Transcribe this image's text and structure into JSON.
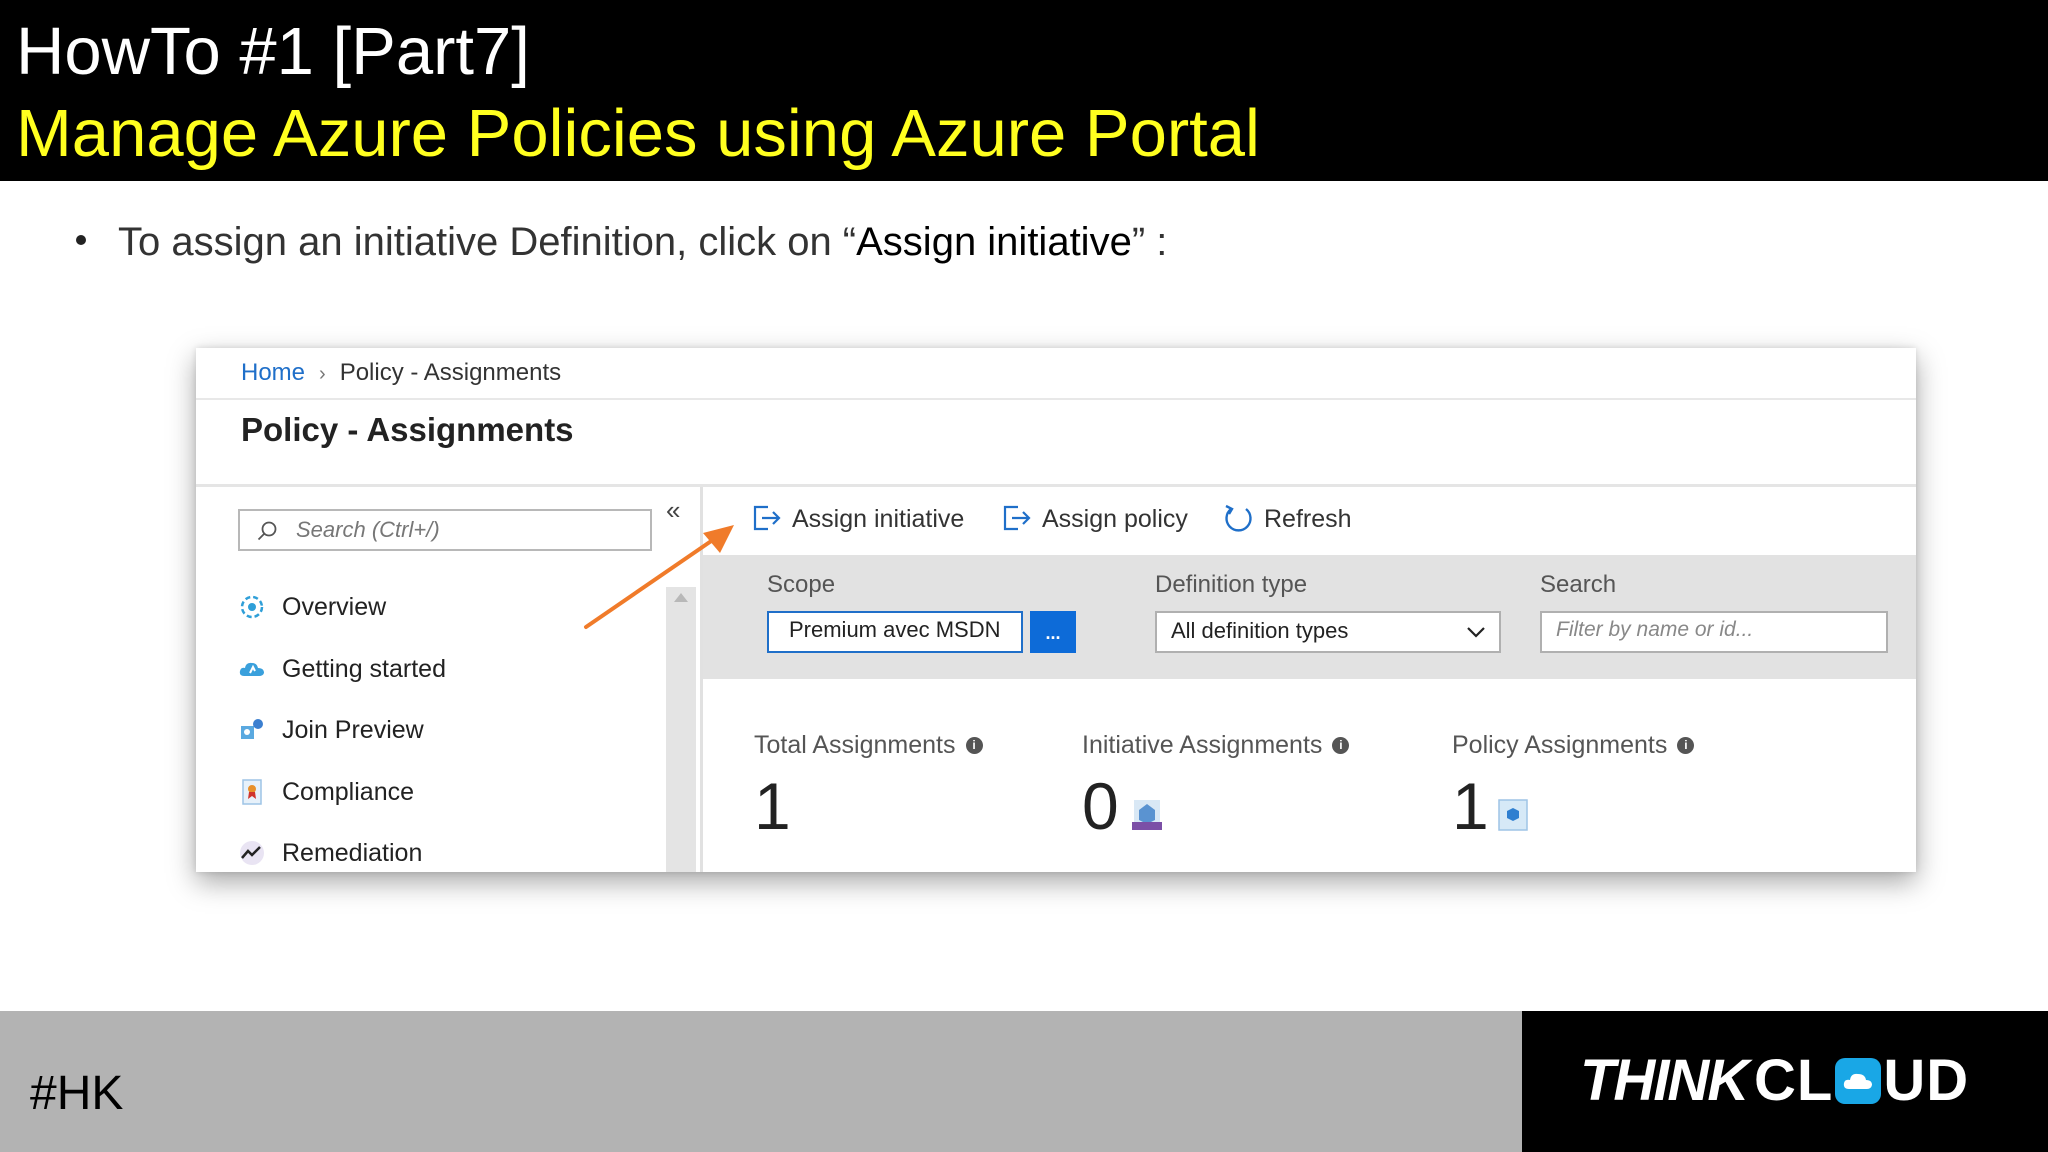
{
  "slide": {
    "title_line1": "HowTo #1 [Part7]",
    "title_line2": "Manage Azure Policies using Azure Portal",
    "bullet_prefix": "To assign an initiative Definition, click on “",
    "bullet_strong": "Assign initiative",
    "bullet_suffix": "” :",
    "colors": {
      "header_bg": "#000000",
      "title2": "#ffff1f",
      "footer_left": "#b3b3b3",
      "footer_right": "#000000",
      "arrow": "#f07b2a"
    }
  },
  "portal": {
    "breadcrumb": {
      "home": "Home",
      "separator": "›",
      "current": "Policy - Assignments"
    },
    "page_title": "Policy - Assignments",
    "search": {
      "placeholder": "Search (Ctrl+/)"
    },
    "collapse_glyph": "«",
    "nav_items": [
      {
        "label": "Overview",
        "icon": "overview-icon"
      },
      {
        "label": "Getting started",
        "icon": "cloud-icon"
      },
      {
        "label": "Join Preview",
        "icon": "preview-icon"
      },
      {
        "label": "Compliance",
        "icon": "compliance-icon"
      },
      {
        "label": "Remediation",
        "icon": "remediation-icon"
      }
    ],
    "toolbar": {
      "assign_initiative": "Assign initiative",
      "assign_policy": "Assign policy",
      "refresh": "Refresh"
    },
    "filters": {
      "scope_label": "Scope",
      "scope_value": "Premium avec MSDN",
      "scope_button": "...",
      "definition_type_label": "Definition type",
      "definition_type_value": "All definition types",
      "search_label": "Search",
      "search_placeholder": "Filter by name or id..."
    },
    "stats": {
      "total_label": "Total Assignments",
      "total_value": "1",
      "initiative_label": "Initiative Assignments",
      "initiative_value": "0",
      "policy_label": "Policy Assignments",
      "policy_value": "1",
      "info_glyph": "i"
    },
    "colors": {
      "link": "#1f6fc9",
      "primary_button": "#0d6bd8",
      "filter_band": "#e2e2e2"
    }
  },
  "footer": {
    "hashtag": "#HK",
    "logo_think": "THINK",
    "logo_cl": "CL",
    "logo_ud": "UD"
  }
}
